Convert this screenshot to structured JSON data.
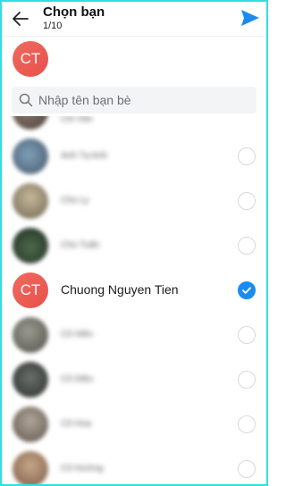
{
  "header": {
    "title": "Chọn bạn",
    "selection_count": "1/10"
  },
  "selected": {
    "avatar_initials": "CT"
  },
  "search": {
    "placeholder": "Nhập tên bạn bè"
  },
  "contacts": [
    {
      "name": "Chi Vân",
      "selected": false,
      "blurred": true
    },
    {
      "name": "Anh Tạ Anh",
      "selected": false,
      "blurred": true
    },
    {
      "name": "Chú Ly",
      "selected": false,
      "blurred": true
    },
    {
      "name": "Chú Tuấn",
      "selected": false,
      "blurred": true
    },
    {
      "name": "Chuong Nguyen Tien",
      "initials": "CT",
      "selected": true,
      "blurred": false
    },
    {
      "name": "Cô Hiền",
      "selected": false,
      "blurred": true
    },
    {
      "name": "Cô Diệu",
      "selected": false,
      "blurred": true
    },
    {
      "name": "Cô Hoa",
      "selected": false,
      "blurred": true
    },
    {
      "name": "Cô Hường",
      "selected": false,
      "blurred": true
    }
  ],
  "colors": {
    "accent": "#1a8cf0",
    "avatar_red": "#e8504a",
    "frame": "#2fe0e0"
  },
  "icons": [
    "back-arrow-icon",
    "send-icon",
    "search-icon",
    "checkmark-icon"
  ]
}
